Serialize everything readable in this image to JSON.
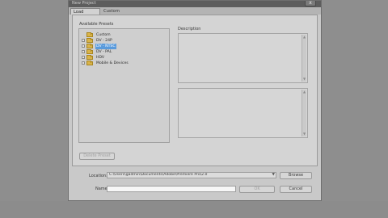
{
  "window": {
    "title": "New Project",
    "close_glyph": "x"
  },
  "tabs": [
    {
      "label": "Load Preset"
    },
    {
      "label": "Custom Settings"
    }
  ],
  "presets": {
    "label": "Available Presets",
    "items": [
      {
        "label": "Custom",
        "selected": false
      },
      {
        "label": "DV - 24P",
        "selected": false
      },
      {
        "label": "DV - NTSC",
        "selected": true
      },
      {
        "label": "DV - PAL",
        "selected": false
      },
      {
        "label": "HDV",
        "selected": false
      },
      {
        "label": "Mobile & Devices",
        "selected": false
      }
    ],
    "delete_button": "Delete Preset"
  },
  "description": {
    "label": "Description"
  },
  "location": {
    "label": "Location:",
    "value": "C:\\Users\\gadmin\\Documents\\Adobe\\Premiere Pro\\2.0",
    "browse_button": "Browse"
  },
  "name": {
    "label": "Name:",
    "value": ""
  },
  "actions": {
    "ok_button": "OK",
    "cancel_button": "Cancel"
  }
}
